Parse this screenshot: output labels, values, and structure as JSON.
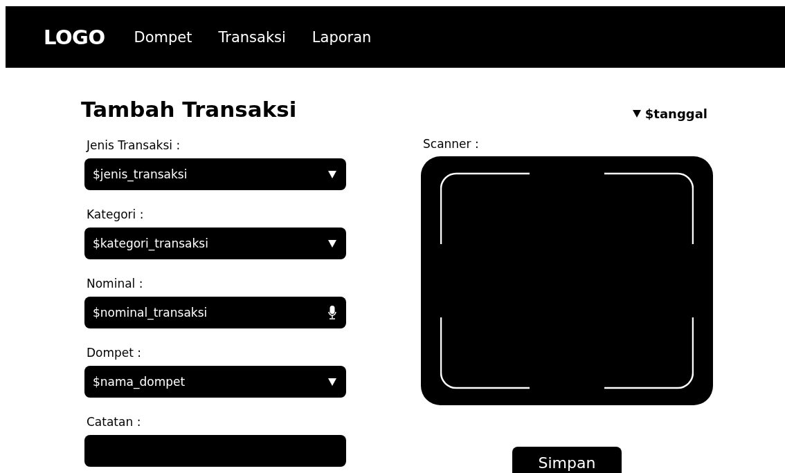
{
  "navbar": {
    "logo": "LOGO",
    "items": [
      {
        "label": "Dompet"
      },
      {
        "label": "Transaksi"
      },
      {
        "label": "Laporan"
      }
    ]
  },
  "title": "Tambah Transaksi",
  "date_picker": {
    "value": "$tanggal"
  },
  "fields": [
    {
      "kind": "select",
      "label": "Jenis Transaksi :",
      "value": "$jenis_transaksi"
    },
    {
      "kind": "select",
      "label": "Kategori :",
      "value": "$kategori_transaksi"
    },
    {
      "kind": "voice",
      "label": "Nominal :",
      "value": "$nominal_transaksi"
    },
    {
      "kind": "select",
      "label": "Dompet :",
      "value": "$nama_dompet"
    },
    {
      "kind": "text",
      "label": "Catatan :"
    }
  ],
  "scanner": {
    "label": "Scanner :"
  },
  "buttons": [
    {
      "label": "Simpan"
    }
  ]
}
